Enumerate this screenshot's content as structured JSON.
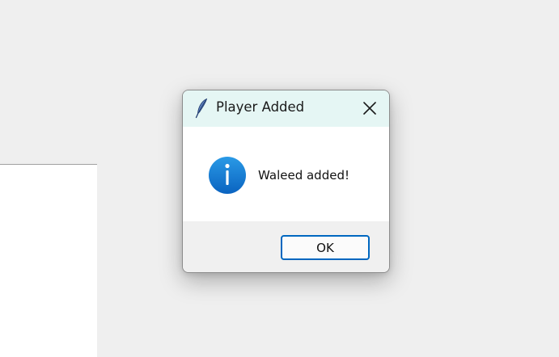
{
  "dialog": {
    "title": "Player Added",
    "message": "Waleed added!",
    "ok_label": "OK"
  },
  "icons": {
    "app": "feather-icon",
    "close": "close-icon",
    "info": "info-icon"
  },
  "colors": {
    "titlebar_bg": "#e5f6f4",
    "ok_border": "#0067c0",
    "info_blue": "#1a7fd6"
  }
}
